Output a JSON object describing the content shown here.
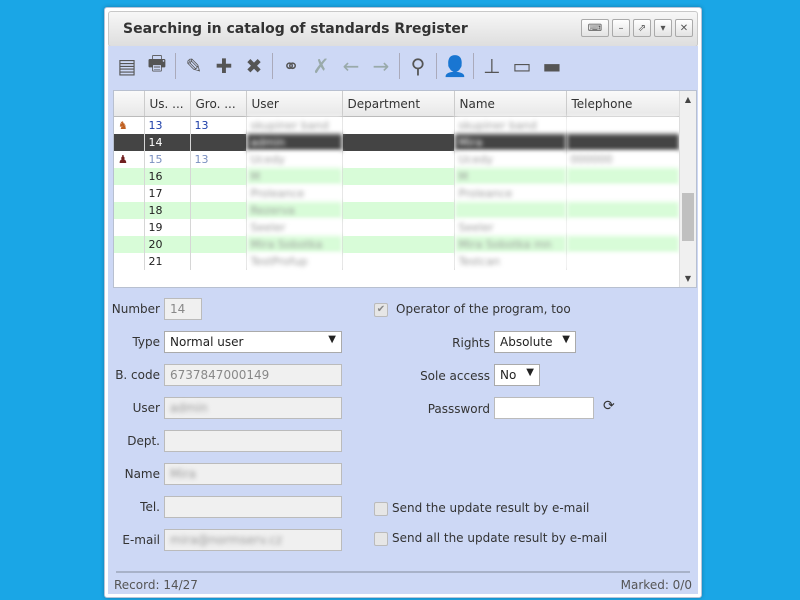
{
  "window": {
    "title": "Searching in catalog of standards Rregister",
    "controls": [
      "keyboard-icon",
      "minimize-icon",
      "popout-icon",
      "dropdown-icon",
      "close-icon"
    ]
  },
  "toolbar": {
    "buttons": [
      "list-view-icon",
      "print-icon",
      "edit-pencil-icon",
      "add-icon",
      "delete-icon",
      "binoculars-icon",
      "clear-search-icon",
      "arrow-left-icon",
      "arrow-right-icon",
      "filter-icon",
      "user-settings-icon",
      "stamp-icon",
      "printer-box-icon",
      "folder-icon"
    ]
  },
  "grid": {
    "columns": [
      "Us. ...",
      "Gro. ...",
      "User",
      "Department",
      "Name",
      "Telephone"
    ],
    "rows": [
      {
        "icon": "user-colored-icon",
        "us": "13",
        "gro": "13",
        "user": "skupiner band",
        "dept": "",
        "name": "skupiner band",
        "tel": "",
        "style": "w",
        "numclass": "blue"
      },
      {
        "icon": "",
        "us": "14",
        "gro": "",
        "user": "admin",
        "dept": "",
        "name": "Mira",
        "tel": "",
        "style": "sel",
        "numclass": ""
      },
      {
        "icon": "user-dark-icon",
        "us": "15",
        "gro": "13",
        "user": "Ucedy",
        "dept": "",
        "name": "Ucedy",
        "tel": "000000",
        "style": "w",
        "numclass": "lblue"
      },
      {
        "icon": "",
        "us": "16",
        "gro": "",
        "user": "M",
        "dept": "",
        "name": "M",
        "tel": "",
        "style": "g",
        "numclass": ""
      },
      {
        "icon": "",
        "us": "17",
        "gro": "",
        "user": "Proleance",
        "dept": "",
        "name": "Proleance",
        "tel": "",
        "style": "w",
        "numclass": ""
      },
      {
        "icon": "",
        "us": "18",
        "gro": "",
        "user": "Rezerva",
        "dept": "",
        "name": "",
        "tel": "",
        "style": "g",
        "numclass": ""
      },
      {
        "icon": "",
        "us": "19",
        "gro": "",
        "user": "Seeler",
        "dept": "",
        "name": "Seeler",
        "tel": "",
        "style": "w",
        "numclass": ""
      },
      {
        "icon": "",
        "us": "20",
        "gro": "",
        "user": "Mira Sobotka",
        "dept": "",
        "name": "Mira Sobotka mn",
        "tel": "",
        "style": "g",
        "numclass": ""
      },
      {
        "icon": "",
        "us": "21",
        "gro": "",
        "user": "TestProfup",
        "dept": "",
        "name": "Testcan",
        "tel": "",
        "style": "w",
        "numclass": ""
      }
    ]
  },
  "form": {
    "number_label": "Number",
    "number_value": "14",
    "type_label": "Type",
    "type_value": "Normal user",
    "bcode_label": "B. code",
    "bcode_value": "6737847000149",
    "user_label": "User",
    "user_value": "admin",
    "dept_label": "Dept.",
    "dept_value": "",
    "name_label": "Name",
    "name_value": "Mira",
    "tel_label": "Tel.",
    "tel_value": "",
    "email_label": "E-mail",
    "email_value": "mira@normserv.cz",
    "operator_label": "Operator of the program, too",
    "rights_label": "Rights",
    "rights_value": "Absolute",
    "sole_label": "Sole access",
    "sole_value": "No",
    "password_label": "Passsword",
    "password_value": "",
    "send_update_label": "Send the update result by e-mail",
    "send_all_label": "Send all the update result by e-mail"
  },
  "status": {
    "record": "Record: 14/27",
    "marked": "Marked: 0/0"
  }
}
